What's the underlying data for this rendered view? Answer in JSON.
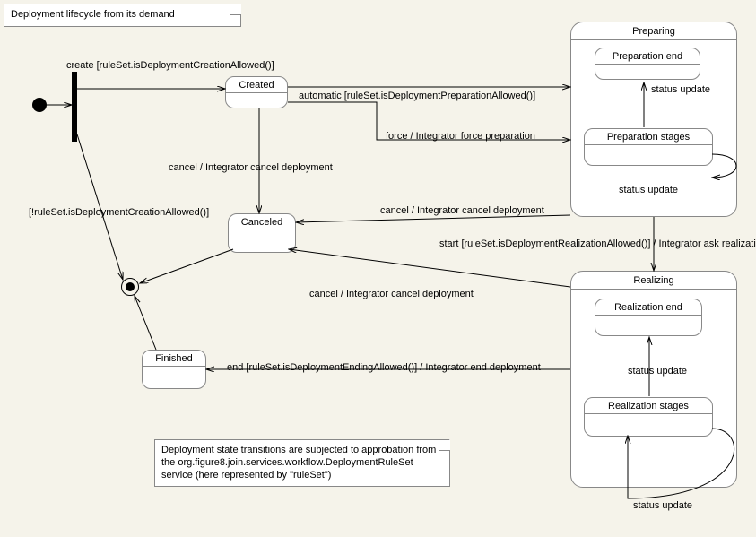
{
  "diagram": {
    "title": "Deployment lifecycle from its demand",
    "footnote": "Deployment state transitions are subjected to approbation from the org.figure8.join.services.workflow.DeploymentRuleSet service (here represented by \"ruleSet\")"
  },
  "states": {
    "created": "Created",
    "canceled": "Canceled",
    "finished": "Finished",
    "preparing": "Preparing",
    "preparation_end": "Preparation end",
    "preparation_stages": "Preparation stages",
    "realizing": "Realizing",
    "realization_end": "Realization end",
    "realization_stages": "Realization stages"
  },
  "transitions": {
    "create": "create [ruleSet.isDeploymentCreationAllowed()]",
    "not_allowed": "[!ruleSet.isDeploymentCreationAllowed()]",
    "automatic_prepare": "automatic [ruleSet.isDeploymentPreparationAllowed()]",
    "force_prepare": "force / Integrator force preparation",
    "cancel_deployment": "cancel / Integrator cancel deployment",
    "start_realize": "start [ruleSet.isDeploymentRealizationAllowed()] / Integrator ask realization",
    "end_deploy": "end [ruleSet.isDeploymentEndingAllowed()] / Integrator end deployment",
    "status_update": "status update"
  }
}
